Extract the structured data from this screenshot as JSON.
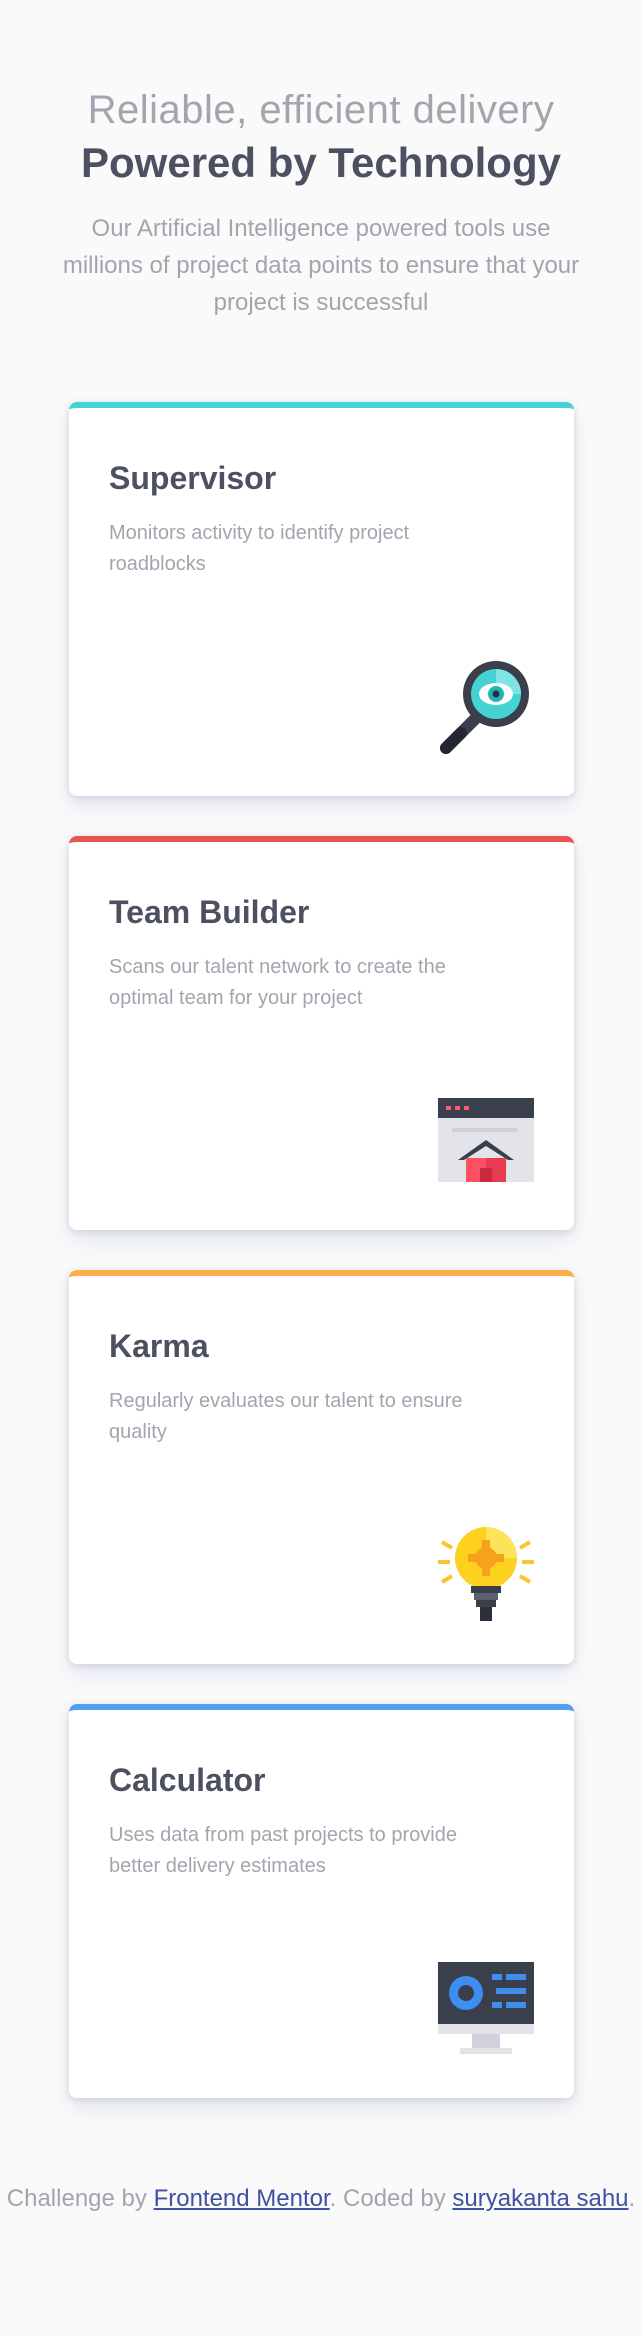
{
  "hero": {
    "line1": "Reliable, efficient delivery",
    "line2": "Powered by Technology",
    "description": "Our Artificial Intelligence powered tools use millions of project data points to ensure that your project is successful"
  },
  "cards": [
    {
      "title": "Supervisor",
      "description": "Monitors activity to identify project roadblocks",
      "accent": "#44d3d2",
      "icon": "supervisor-magnifier-icon"
    },
    {
      "title": "Team Builder",
      "description": "Scans our talent network to create the optimal team for your project",
      "accent": "#ea5454",
      "icon": "team-builder-window-icon"
    },
    {
      "title": "Karma",
      "description": "Regularly evaluates our talent to ensure quality",
      "accent": "#fcae4a",
      "icon": "karma-lightbulb-icon"
    },
    {
      "title": "Calculator",
      "description": "Uses data from past projects to provide better delivery estimates",
      "accent": "#549ef2",
      "icon": "calculator-monitor-icon"
    }
  ],
  "footer": {
    "prefix": "Challenge by",
    "link1": "Frontend Mentor",
    "middle": ". Coded by",
    "link2": "suryakanta sahu",
    "suffix": "."
  }
}
